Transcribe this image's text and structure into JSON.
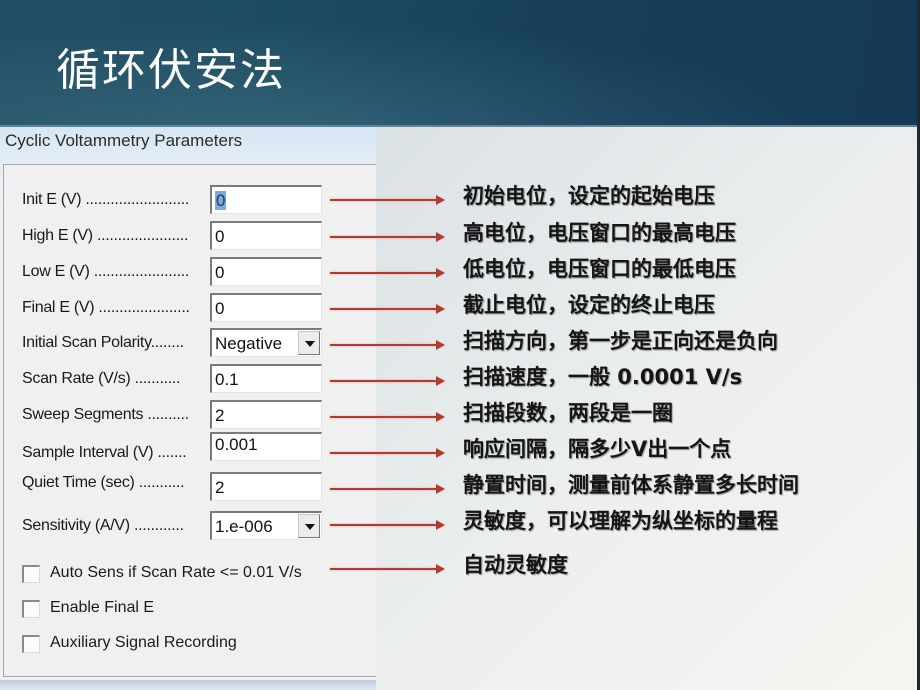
{
  "slide": {
    "title": "循环伏安法"
  },
  "dialog": {
    "title": "Cyclic Voltammetry Parameters",
    "params": [
      {
        "label": "Init E (V) .........................",
        "value": "0",
        "type": "input",
        "selected": true
      },
      {
        "label": "High E (V) ......................",
        "value": "0",
        "type": "input"
      },
      {
        "label": "Low E (V) .......................",
        "value": "0",
        "type": "input"
      },
      {
        "label": "Final E (V) ......................",
        "value": "0",
        "type": "input"
      },
      {
        "label": "Initial Scan Polarity........",
        "value": "Negative",
        "type": "select"
      },
      {
        "label": "Scan Rate (V/s) ...........",
        "value": "0.1",
        "type": "input"
      },
      {
        "label": "Sweep Segments ..........",
        "value": "2",
        "type": "input"
      },
      {
        "label": "Sample Interval (V) .......",
        "value": "0.001",
        "type": "input"
      },
      {
        "label": "Quiet Time (sec) ...........",
        "value": "2",
        "type": "input"
      },
      {
        "label": "Sensitivity (A/V) ............",
        "value": "1.e-006",
        "type": "select"
      }
    ],
    "checkboxes": [
      {
        "label": "Auto Sens if Scan Rate <= 0.01 V/s",
        "checked": false
      },
      {
        "label": "Enable Final E",
        "checked": false
      },
      {
        "label": "Auxiliary Signal Recording",
        "checked": false
      }
    ]
  },
  "annotations": [
    "初始电位，设定的起始电压",
    "高电位，电压窗口的最高电压",
    "低电位，电压窗口的最低电压",
    "截止电位，设定的终止电压",
    "扫描方向，第一步是正向还是负向",
    "扫描速度，一般 0.0001 V/s",
    "扫描段数，两段是一圈",
    "响应间隔，隔多少V出一个点",
    "静置时间，测量前体系静置多长时间",
    "灵敏度，可以理解为纵坐标的量程",
    "自动灵敏度"
  ],
  "colors": {
    "header": "#1d4b60",
    "arrow": "#b33a2e",
    "selection": "#7ea9d9"
  }
}
